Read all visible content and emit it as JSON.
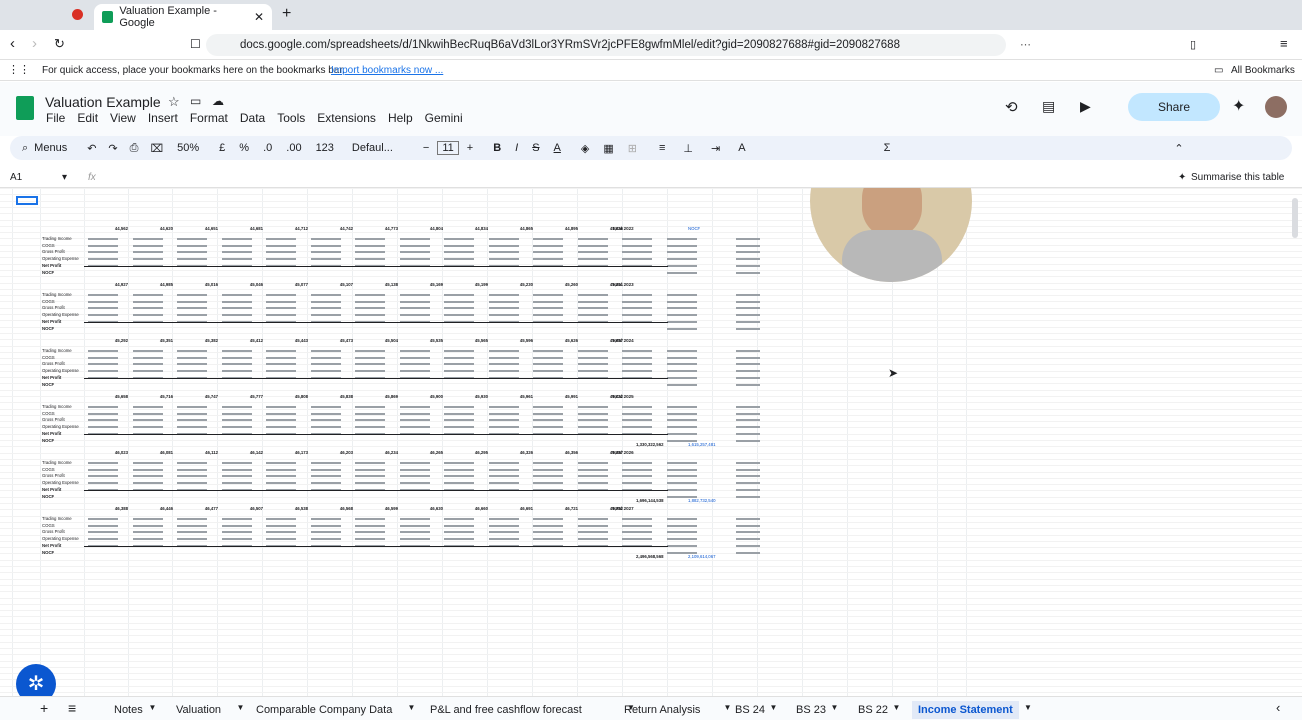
{
  "browser": {
    "tab_title": "Valuation Example - Google",
    "url": "docs.google.com/spreadsheets/d/1NkwihBecRuqB6aVd3lLor3YRmSVr2jcPFE8gwfmMlel/edit?gid=2090827688#gid=2090827688",
    "bookmark_hint": "For quick access, place your bookmarks here on the bookmarks bar.",
    "import_link": "Import bookmarks now ...",
    "all_bookmarks": "All Bookmarks"
  },
  "doc": {
    "title": "Valuation Example",
    "menus": [
      "File",
      "Edit",
      "View",
      "Insert",
      "Format",
      "Data",
      "Tools",
      "Extensions",
      "Help",
      "Gemini"
    ],
    "share_label": "Share"
  },
  "toolbar": {
    "menus_label": "Menus",
    "zoom": "50%",
    "currency": "£",
    "percent": "%",
    "dec_minus": ".0",
    "dec_plus": ".00",
    "number_format": "123",
    "font": "Defaul...",
    "font_size": "11",
    "summarise": "Summarise this table"
  },
  "formula": {
    "cell_ref": "A1",
    "fx": "fx"
  },
  "blocks": [
    {
      "years": [
        "44,562",
        "44,620",
        "44,651",
        "44,681",
        "44,712",
        "44,742",
        "44,773",
        "44,804",
        "44,834",
        "44,865",
        "44,895",
        "44,926"
      ],
      "total": "Total 2022",
      "right": "NOCF",
      "right_total": ""
    },
    {
      "years": [
        "44,927",
        "44,985",
        "45,016",
        "45,046",
        "45,077",
        "45,107",
        "45,138",
        "45,169",
        "45,199",
        "45,230",
        "45,260",
        "45,291"
      ],
      "total": "Total 2023",
      "right": "",
      "right_total": ""
    },
    {
      "years": [
        "45,292",
        "45,351",
        "45,382",
        "45,412",
        "45,443",
        "45,473",
        "45,504",
        "45,535",
        "45,565",
        "45,596",
        "45,626",
        "45,657"
      ],
      "total": "Total 2024",
      "right": "",
      "right_total": ""
    },
    {
      "years": [
        "45,658",
        "45,716",
        "45,747",
        "45,777",
        "45,808",
        "45,838",
        "45,869",
        "45,900",
        "45,930",
        "45,961",
        "45,991",
        "46,022"
      ],
      "total": "Total 2025",
      "right": "1,615,257,481",
      "right_total": "1,330,322,562"
    },
    {
      "years": [
        "46,023",
        "46,081",
        "46,112",
        "46,142",
        "46,173",
        "46,203",
        "46,234",
        "46,265",
        "46,295",
        "46,326",
        "46,356",
        "46,387"
      ],
      "total": "Total 2026",
      "right": "1,882,732,540",
      "right_total": "1,696,144,538"
    },
    {
      "years": [
        "46,388",
        "46,446",
        "46,477",
        "46,507",
        "46,538",
        "46,568",
        "46,599",
        "46,630",
        "46,660",
        "46,691",
        "46,721",
        "46,752"
      ],
      "total": "Total 2027",
      "right": "2,109,614,067",
      "right_total": "2,496,568,568"
    }
  ],
  "row_labels": [
    "Trading Income",
    "COGS",
    "Gross Profit",
    "Operating Expense",
    "Net Profit",
    "NOCF"
  ],
  "sheets": [
    "Notes",
    "Valuation",
    "Comparable Company Data",
    "P&L and free cashflow forecast",
    "Return Analysis",
    "BS 24",
    "BS 23",
    "BS 22",
    "Income Statement"
  ],
  "active_sheet": "Income Statement",
  "colors": {
    "accent": "#0b57d0",
    "sheets_green": "#0f9d58",
    "active_tab_bg": "#e1e9f7"
  }
}
